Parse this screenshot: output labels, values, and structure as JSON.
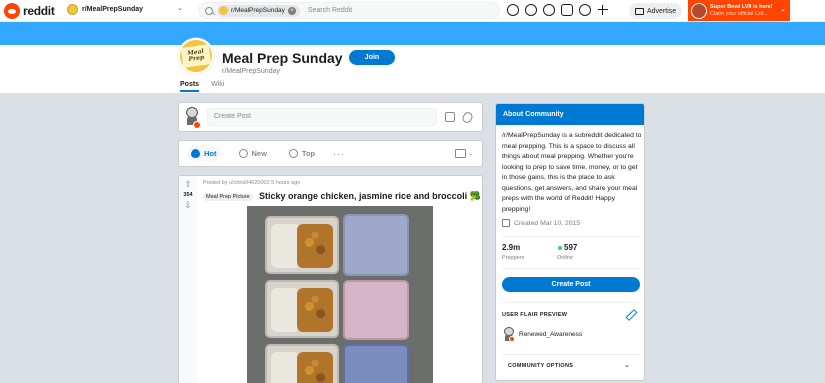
{
  "header": {
    "logo_text": "reddit",
    "community_switcher": "r/MealPrepSunday",
    "search_chip": "r/MealPrepSunday",
    "search_placeholder": "Search Reddit",
    "advertise_label": "Advertise",
    "promo_line1": "Super Bowl LVII is here!",
    "promo_line2": "Claim your official Col..."
  },
  "subreddit": {
    "logo_text": "Meal Prep",
    "title": "Meal Prep Sunday",
    "name": "r/MealPrepSunday",
    "join_label": "Join",
    "tabs": [
      {
        "label": "Posts",
        "active": true
      },
      {
        "label": "Wiki",
        "active": false
      }
    ]
  },
  "create_post": {
    "placeholder": "Create Post"
  },
  "sort": {
    "options": [
      {
        "label": "Hot",
        "active": true
      },
      {
        "label": "New",
        "active": false
      },
      {
        "label": "Top",
        "active": false
      }
    ],
    "more": "···"
  },
  "post": {
    "score": "354",
    "meta": "Posted by u/chris04620002 5 hours ago",
    "flair": "Meal Prep Picture",
    "title": "Sticky orange chicken, jasmine rice and broccoli 🥦"
  },
  "sidebar": {
    "heading": "About Community",
    "description": "/r/MealPrepSunday is a subreddit dedicated to meal prepping. This is a space to discuss all things about meal prepping. Whether you're looking to prep to save time, money, or to get in those gains, this is the place to ask questions, get answers, and share your meal preps with the world of Reddit! Happy prepping!",
    "created": "Created Mar 10, 2015",
    "members_value": "2.9m",
    "members_label": "Preppers",
    "online_value": "597",
    "online_label": "Online",
    "create_post_label": "Create Post",
    "flair_preview_label": "USER FLAIR PREVIEW",
    "flair_username": "Renewed_Awareness",
    "community_options_label": "COMMUNITY OPTIONS"
  },
  "colors": {
    "brand": "#ff4500",
    "accent": "#0079d3",
    "banner": "#33a8ff",
    "online": "#46d160"
  }
}
